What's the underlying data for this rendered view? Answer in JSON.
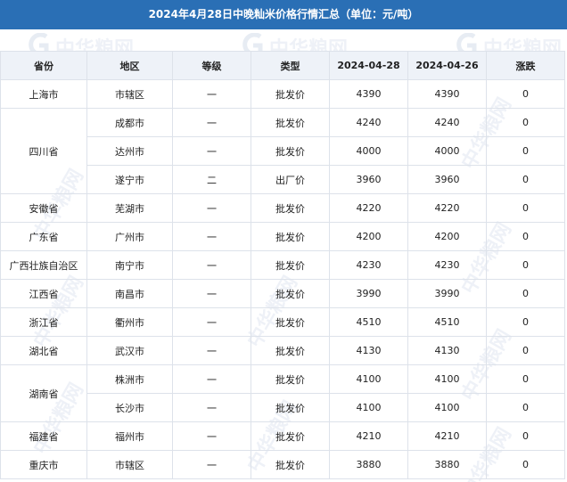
{
  "title": "2024年4月28日中晚籼米价格行情汇总（单位：元/吨）",
  "watermark": {
    "text": "中华粮网",
    "color": "#7896be"
  },
  "colors": {
    "title_bg": "#2a6fb5",
    "header_bg": "#eef2f8",
    "border": "#dde2ea"
  },
  "table": {
    "headers": [
      "省份",
      "地区",
      "等级",
      "类型",
      "2024-04-28",
      "2024-04-26",
      "涨跌"
    ],
    "rows": [
      {
        "province": "上海市",
        "region": "市辖区",
        "grade": "一",
        "type": "批发价",
        "price_0428": "4390",
        "price_0426": "4390",
        "change": "0"
      },
      {
        "province": "四川省",
        "region": "成都市",
        "grade": "一",
        "type": "批发价",
        "price_0428": "4240",
        "price_0426": "4240",
        "change": "0"
      },
      {
        "province": "",
        "region": "达州市",
        "grade": "一",
        "type": "批发价",
        "price_0428": "4000",
        "price_0426": "4000",
        "change": "0"
      },
      {
        "province": "",
        "region": "遂宁市",
        "grade": "二",
        "type": "出厂价",
        "price_0428": "3960",
        "price_0426": "3960",
        "change": "0"
      },
      {
        "province": "安徽省",
        "region": "芜湖市",
        "grade": "一",
        "type": "批发价",
        "price_0428": "4220",
        "price_0426": "4220",
        "change": "0"
      },
      {
        "province": "广东省",
        "region": "广州市",
        "grade": "一",
        "type": "批发价",
        "price_0428": "4200",
        "price_0426": "4200",
        "change": "0"
      },
      {
        "province": "广西壮族自治区",
        "region": "南宁市",
        "grade": "一",
        "type": "批发价",
        "price_0428": "4230",
        "price_0426": "4230",
        "change": "0"
      },
      {
        "province": "江西省",
        "region": "南昌市",
        "grade": "一",
        "type": "批发价",
        "price_0428": "3990",
        "price_0426": "3990",
        "change": "0"
      },
      {
        "province": "浙江省",
        "region": "衢州市",
        "grade": "一",
        "type": "批发价",
        "price_0428": "4510",
        "price_0426": "4510",
        "change": "0"
      },
      {
        "province": "湖北省",
        "region": "武汉市",
        "grade": "一",
        "type": "批发价",
        "price_0428": "4130",
        "price_0426": "4130",
        "change": "0"
      },
      {
        "province": "湖南省",
        "region": "株洲市",
        "grade": "一",
        "type": "批发价",
        "price_0428": "4100",
        "price_0426": "4100",
        "change": "0"
      },
      {
        "province": "",
        "region": "长沙市",
        "grade": "一",
        "type": "批发价",
        "price_0428": "4100",
        "price_0426": "4100",
        "change": "0"
      },
      {
        "province": "福建省",
        "region": "福州市",
        "grade": "一",
        "type": "批发价",
        "price_0428": "4210",
        "price_0426": "4210",
        "change": "0"
      },
      {
        "province": "重庆市",
        "region": "市辖区",
        "grade": "一",
        "type": "批发价",
        "price_0428": "3880",
        "price_0426": "3880",
        "change": "0"
      }
    ]
  }
}
